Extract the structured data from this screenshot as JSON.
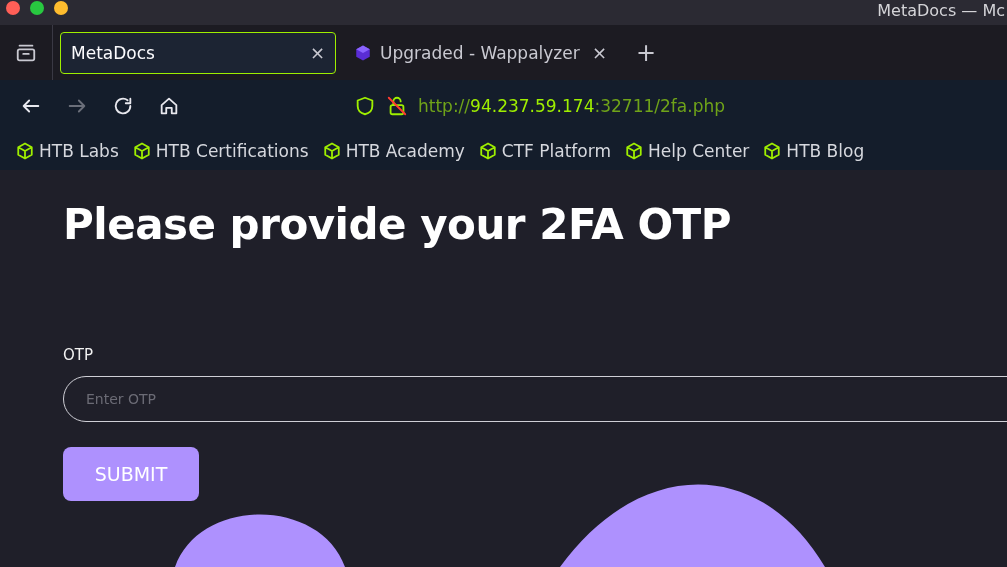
{
  "window": {
    "title": "MetaDocs — Mc"
  },
  "tabs": [
    {
      "label": "MetaDocs",
      "selected": true,
      "close": "×",
      "kind": "plain"
    },
    {
      "label": "Upgraded - Wappalyzer",
      "selected": false,
      "close": "×",
      "kind": "extension"
    }
  ],
  "new_tab": "+",
  "address_bar": {
    "scheme": "http://",
    "host": "94.237.59.174",
    "rest": ":32711/2fa.php"
  },
  "bookmarks": [
    "HTB Labs",
    "HTB Certifications",
    "HTB Academy",
    "CTF Platform",
    "Help Center",
    "HTB Blog"
  ],
  "page": {
    "heading": "Please provide your 2FA OTP",
    "field_label": "OTP",
    "placeholder": "Enter OTP",
    "submit": "SUBMIT"
  }
}
